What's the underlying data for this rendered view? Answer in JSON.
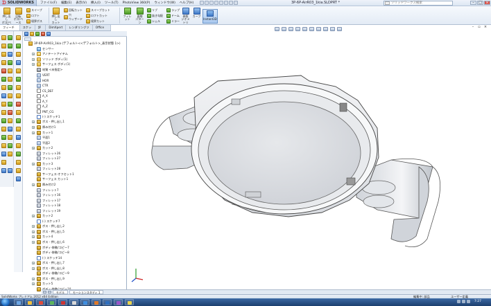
{
  "app": {
    "brand": "SOLIDWORKS",
    "document_title": "3P-6P-AirR03_1kia.SLDPRT *",
    "search_placeholder": "ソリッドワークス検索",
    "menu": [
      "ファイル(F)",
      "編集(E)",
      "表示(V)",
      "挿入(I)",
      "ツール(T)",
      "PhotoView 360(P)",
      "ウィンドウ(W)",
      "ヘルプ(H)"
    ]
  },
  "ribbon": {
    "groups": [
      {
        "label": "押し出し\nボス/ベース"
      },
      {
        "label": "回転\nボス/ベース"
      },
      {
        "label": "スイープ"
      },
      {
        "label": "ロフト"
      },
      {
        "label": "境界ボス"
      },
      {
        "label": "押し出し\nカット"
      },
      {
        "label": "回転カット"
      },
      {
        "label": "穴\nウィザード"
      },
      {
        "label": "スイープカット"
      },
      {
        "label": "ロフトカット"
      },
      {
        "label": "境界カット"
      },
      {
        "label": "フィレット"
      },
      {
        "label": "直線\nパターン"
      },
      {
        "label": "リブ"
      },
      {
        "label": "抜き勾配"
      },
      {
        "label": "シェル"
      },
      {
        "label": "ラップ"
      },
      {
        "label": "ドーム"
      },
      {
        "label": "ミラー"
      },
      {
        "label": "参照\nジオメトリ"
      },
      {
        "label": "カーブ"
      }
    ],
    "instant3d": "Instant3D"
  },
  "tabs": [
    "フィーチャー",
    "スケッチ",
    "評価",
    "DimXpert",
    "レンダリングツール",
    "Office 製品"
  ],
  "feature_tree": {
    "root": "3P-6P-AirR03_1kia (デフォルト<<デフォルト>_表示状態 1>)",
    "items": [
      {
        "label": "センサー",
        "icon": "sensor"
      },
      {
        "label": "アノテートアイテム",
        "icon": "annot",
        "exp": true
      },
      {
        "label": "ソリッド ボディ(1)",
        "icon": "folder",
        "exp": true
      },
      {
        "label": "サーフェス ボディ(1)",
        "icon": "folder",
        "exp": true
      },
      {
        "label": "材質 <未指定>",
        "icon": "mat"
      },
      {
        "label": "VERT",
        "icon": "plane"
      },
      {
        "label": "HOR",
        "icon": "plane"
      },
      {
        "label": "CTR",
        "icon": "plane"
      },
      {
        "label": "CS_DEF",
        "icon": "axis"
      },
      {
        "label": "A_X",
        "icon": "axis"
      },
      {
        "label": "A_Y",
        "icon": "axis"
      },
      {
        "label": "A_Z",
        "icon": "axis"
      },
      {
        "label": "PNT_CG",
        "icon": "axis"
      },
      {
        "label": "(-) スケッチ1",
        "icon": "sketch"
      },
      {
        "label": "ボス - 押し出し1",
        "icon": "extr",
        "exp": true
      },
      {
        "label": "厚み付け1",
        "icon": "extr",
        "exp": true
      },
      {
        "label": "カット1",
        "icon": "extr",
        "exp": true
      },
      {
        "label": "平面1",
        "icon": "plane"
      },
      {
        "label": "平面2",
        "icon": "plane"
      },
      {
        "label": "カット2",
        "icon": "extr",
        "exp": true
      },
      {
        "label": "フィレット26",
        "icon": "fillet"
      },
      {
        "label": "フィレット27",
        "icon": "fillet"
      },
      {
        "label": "カット3",
        "icon": "extr",
        "exp": true
      },
      {
        "label": "フィレット28",
        "icon": "fillet"
      },
      {
        "label": "サーフェス-オフセット1",
        "icon": "extr"
      },
      {
        "label": "サーフェス カット1",
        "icon": "extr"
      },
      {
        "label": "厚み付け2",
        "icon": "extr",
        "exp": true
      },
      {
        "label": "フィレット7",
        "icon": "fillet"
      },
      {
        "label": "フィレット16",
        "icon": "fillet"
      },
      {
        "label": "フィレット17",
        "icon": "fillet"
      },
      {
        "label": "フィレット18",
        "icon": "fillet"
      },
      {
        "label": "フィレット19",
        "icon": "fillet"
      },
      {
        "label": "カット2",
        "icon": "extr",
        "exp": true
      },
      {
        "label": "(-) スケッチ7",
        "icon": "sketch"
      },
      {
        "label": "ボス - 押し出し2",
        "icon": "extr",
        "exp": true
      },
      {
        "label": "ボス - 押し出し5",
        "icon": "extr",
        "exp": true
      },
      {
        "label": "カット4",
        "icon": "extr",
        "exp": true
      },
      {
        "label": "ボス - 押し出し6",
        "icon": "extr",
        "exp": true
      },
      {
        "label": "ボディ-移動/コピー7",
        "icon": "extr"
      },
      {
        "label": "ボディ-移動/コピー8",
        "icon": "extr"
      },
      {
        "label": "(-) スケッチ14",
        "icon": "sketch"
      },
      {
        "label": "ボス - 押し出し7",
        "icon": "extr",
        "exp": true
      },
      {
        "label": "ボス - 押し出し8",
        "icon": "extr",
        "exp": true
      },
      {
        "label": "ボディ-移動/コピー9",
        "icon": "extr"
      },
      {
        "label": "ボス - 押し出し9",
        "icon": "extr",
        "exp": true
      },
      {
        "label": "カット5",
        "icon": "extr",
        "exp": true
      },
      {
        "label": "ボディ-移動/コピー10",
        "icon": "extr"
      }
    ]
  },
  "sheet_tabs": [
    "モデル",
    "モーションスタディ 1"
  ],
  "status": {
    "left": "SolidWorks プレミアム 2012 x64 Edition",
    "edit_mode": "編集中: 部品",
    "units": "ユーザー定義",
    "clock": "7:27"
  }
}
